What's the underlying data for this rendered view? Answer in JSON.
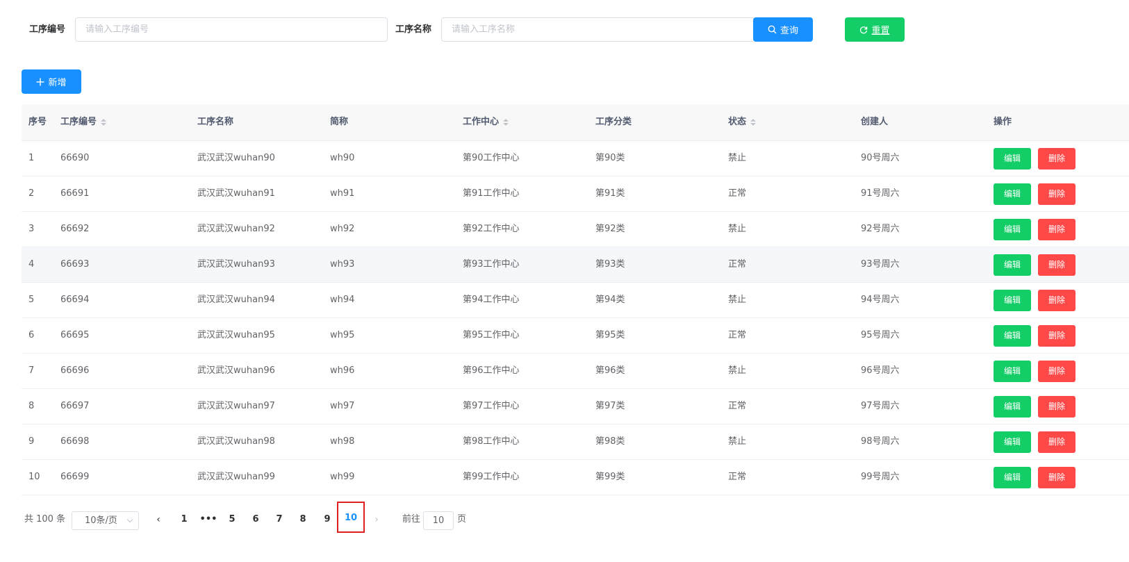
{
  "search": {
    "code_label": "工序编号",
    "code_placeholder": "请输入工序编号",
    "name_label": "工序名称",
    "name_placeholder": "请输入工序名称",
    "query_label": "查询",
    "reset_label": "重置"
  },
  "toolbar": {
    "add_label": "新增"
  },
  "table": {
    "headers": {
      "index": "序号",
      "code": "工序编号",
      "name": "工序名称",
      "short": "简称",
      "center": "工作中心",
      "category": "工序分类",
      "status": "状态",
      "creator": "创建人",
      "ops": "操作"
    },
    "rows": [
      {
        "index": "1",
        "code": "66690",
        "name": "武汉武汉wuhan90",
        "short": "wh90",
        "center": "第90工作中心",
        "category": "第90类",
        "status": "禁止",
        "creator": "90号周六"
      },
      {
        "index": "2",
        "code": "66691",
        "name": "武汉武汉wuhan91",
        "short": "wh91",
        "center": "第91工作中心",
        "category": "第91类",
        "status": "正常",
        "creator": "91号周六"
      },
      {
        "index": "3",
        "code": "66692",
        "name": "武汉武汉wuhan92",
        "short": "wh92",
        "center": "第92工作中心",
        "category": "第92类",
        "status": "禁止",
        "creator": "92号周六"
      },
      {
        "index": "4",
        "code": "66693",
        "name": "武汉武汉wuhan93",
        "short": "wh93",
        "center": "第93工作中心",
        "category": "第93类",
        "status": "正常",
        "creator": "93号周六"
      },
      {
        "index": "5",
        "code": "66694",
        "name": "武汉武汉wuhan94",
        "short": "wh94",
        "center": "第94工作中心",
        "category": "第94类",
        "status": "禁止",
        "creator": "94号周六"
      },
      {
        "index": "6",
        "code": "66695",
        "name": "武汉武汉wuhan95",
        "short": "wh95",
        "center": "第95工作中心",
        "category": "第95类",
        "status": "正常",
        "creator": "95号周六"
      },
      {
        "index": "7",
        "code": "66696",
        "name": "武汉武汉wuhan96",
        "short": "wh96",
        "center": "第96工作中心",
        "category": "第96类",
        "status": "禁止",
        "creator": "96号周六"
      },
      {
        "index": "8",
        "code": "66697",
        "name": "武汉武汉wuhan97",
        "short": "wh97",
        "center": "第97工作中心",
        "category": "第97类",
        "status": "正常",
        "creator": "97号周六"
      },
      {
        "index": "9",
        "code": "66698",
        "name": "武汉武汉wuhan98",
        "short": "wh98",
        "center": "第98工作中心",
        "category": "第98类",
        "status": "禁止",
        "creator": "98号周六"
      },
      {
        "index": "10",
        "code": "66699",
        "name": "武汉武汉wuhan99",
        "short": "wh99",
        "center": "第99工作中心",
        "category": "第99类",
        "status": "正常",
        "creator": "99号周六"
      }
    ],
    "edit_label": "编辑",
    "delete_label": "删除"
  },
  "pagination": {
    "total_text": "共 100 条",
    "page_size": "10条/页",
    "pages": [
      "1",
      "•••",
      "5",
      "6",
      "7",
      "8",
      "9",
      "10"
    ],
    "current": "10",
    "goto_label": "前往",
    "goto_value": "10",
    "page_suffix": "页"
  },
  "colors": {
    "primary": "#1890ff",
    "success": "#13ce66",
    "danger": "#ff4949"
  }
}
